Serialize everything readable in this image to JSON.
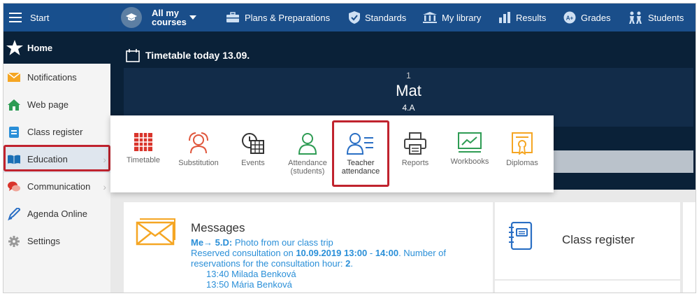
{
  "topbar": {
    "start_label": "Start",
    "course_label_1": "All my",
    "course_label_2": "courses",
    "nav": [
      {
        "label": "Plans & Preparations",
        "icon": "briefcase-icon"
      },
      {
        "label": "Standards",
        "icon": "shield-check-icon"
      },
      {
        "label": "My library",
        "icon": "library-icon"
      },
      {
        "label": "Results",
        "icon": "bar-chart-icon"
      },
      {
        "label": "Grades",
        "icon": "grades-icon"
      },
      {
        "label": "Students",
        "icon": "students-icon"
      }
    ]
  },
  "sidebar": {
    "home": "Home",
    "items": [
      {
        "label": "Notifications",
        "icon": "envelope-icon"
      },
      {
        "label": "Web page",
        "icon": "house-icon"
      },
      {
        "label": "Class register",
        "icon": "register-icon"
      },
      {
        "label": "Education",
        "icon": "book-icon"
      },
      {
        "label": "Communication",
        "icon": "chat-icon"
      },
      {
        "label": "Agenda Online",
        "icon": "pencil-icon"
      },
      {
        "label": "Settings",
        "icon": "gear-icon"
      }
    ]
  },
  "timetable": {
    "title": "Timetable today 13.09.",
    "lesson_number": "1",
    "subject": "Mat",
    "class": "4.A"
  },
  "education_menu": {
    "items": [
      {
        "label": "Timetable",
        "icon": "timetable-icon"
      },
      {
        "label": "Substitution",
        "icon": "substitution-icon"
      },
      {
        "label": "Events",
        "icon": "events-icon"
      },
      {
        "label_1": "Attendance",
        "label_2": "(students)",
        "icon": "attendance-icon"
      },
      {
        "label_1": "Teacher",
        "label_2": "attendance",
        "icon": "teacher-attendance-icon"
      },
      {
        "label": "Reports",
        "icon": "printer-icon"
      },
      {
        "label": "Workbooks",
        "icon": "workbook-icon"
      },
      {
        "label": "Diplomas",
        "icon": "diploma-icon"
      }
    ]
  },
  "messages": {
    "title": "Messages",
    "line1_prefix": "Me→ ",
    "line1_bold": "5.D:",
    "line1_rest": " Photo from our class trip",
    "line2_a": "Reserved consultation on ",
    "line2_b": "10.09.2019 13:00",
    "line2_c": " - ",
    "line2_d": "14:00",
    "line2_e": ". Number of reservations for the consultation hour: ",
    "line2_f": "2",
    "line2_g": ".",
    "entries": [
      "13:40 Milada Benková",
      "13:50 Mária Benková"
    ]
  },
  "class_register_card": {
    "label": "Class register"
  },
  "colors": {
    "topbar": "#1a4e8a",
    "dark_bg": "#0a2138",
    "highlight": "#c0232e",
    "link": "#2a8fd8"
  }
}
